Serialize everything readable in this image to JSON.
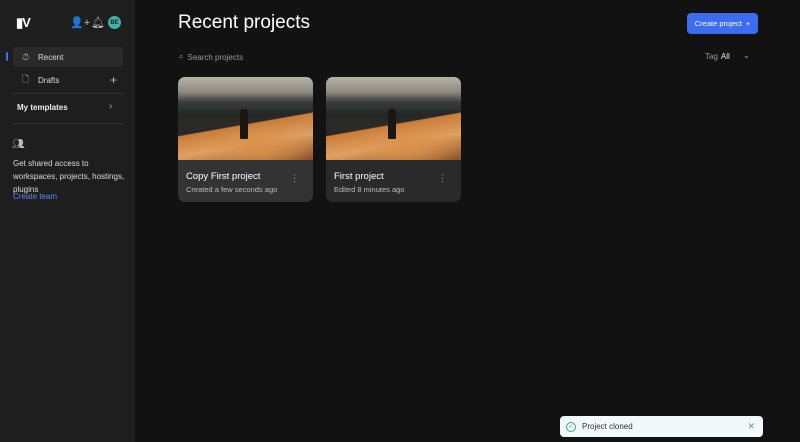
{
  "sidebar": {
    "logo": "▮V",
    "items": [
      {
        "label": "Recent",
        "icon": "stopwatch-icon"
      },
      {
        "label": "Drafts",
        "icon": "file-icon"
      }
    ],
    "templates": "My templates",
    "share_text": "Get shared access to workspaces, projects, hostings, plugins",
    "create_team": "Create team",
    "avatar": "BE"
  },
  "main": {
    "title": "Recent projects",
    "create_button": "Create project",
    "search_placeholder": "Search projects",
    "tag_label": "Tag",
    "tag_value": "All",
    "projects": [
      {
        "title": "Copy First project",
        "subtitle": "Created a few seconds ago"
      },
      {
        "title": "First project",
        "subtitle": "Edited 8 minutes ago"
      }
    ]
  },
  "toast": {
    "message": "Project cloned"
  },
  "colors": {
    "accent": "#3d6cf0",
    "sidebar": "#1e1e1e",
    "background": "#121212"
  }
}
